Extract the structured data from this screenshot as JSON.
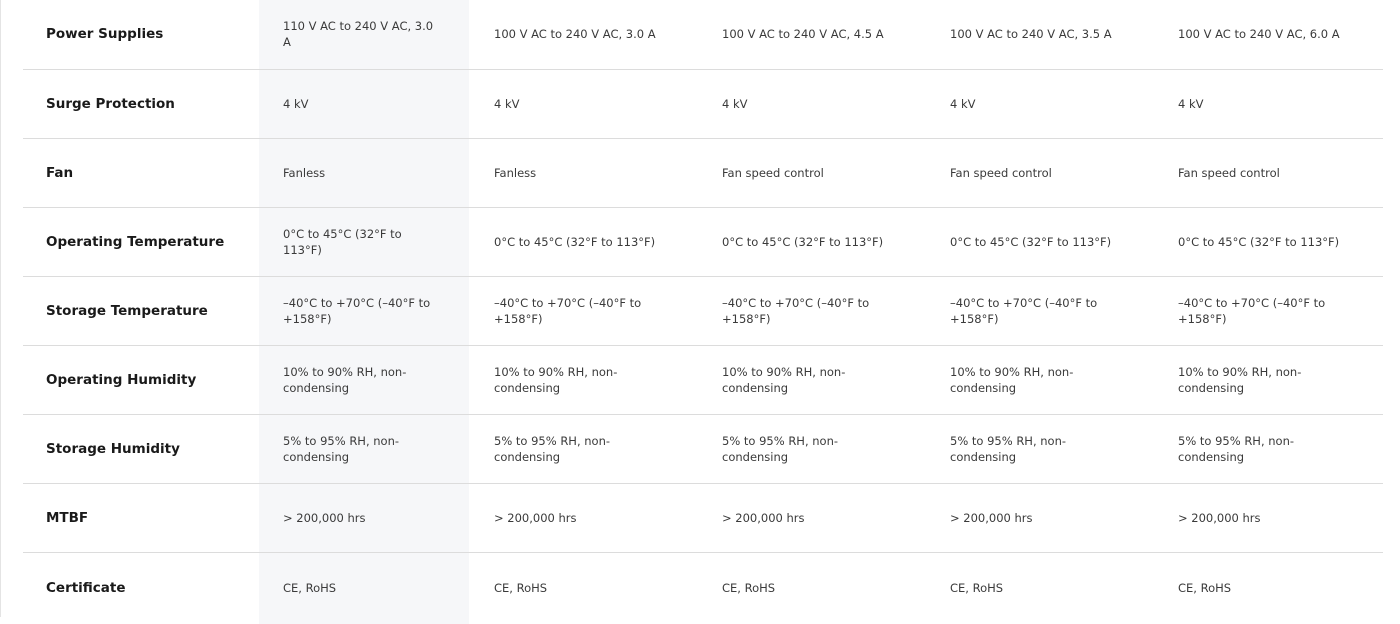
{
  "rows": [
    {
      "label": "Power Supplies",
      "values": [
        "110 V AC to 240 V AC, 3.0 A",
        "100 V AC to 240 V AC, 3.0 A",
        "100 V AC to 240 V AC, 4.5 A",
        "100 V AC to 240 V AC, 3.5 A",
        "100 V AC to 240 V AC, 6.0 A"
      ]
    },
    {
      "label": "Surge Protection",
      "values": [
        "4 kV",
        "4 kV",
        "4 kV",
        "4 kV",
        "4 kV"
      ]
    },
    {
      "label": "Fan",
      "values": [
        "Fanless",
        "Fanless",
        "Fan speed control",
        "Fan speed control",
        "Fan speed control"
      ]
    },
    {
      "label": "Operating Temperature",
      "values": [
        "0°C to 45°C (32°F to 113°F)",
        "0°C to 45°C (32°F to 113°F)",
        "0°C to 45°C (32°F to 113°F)",
        "0°C to 45°C (32°F to 113°F)",
        "0°C to 45°C (32°F to 113°F)"
      ]
    },
    {
      "label": "Storage Temperature",
      "values": [
        "–40°C to +70°C (–40°F to +158°F)",
        "–40°C to +70°C (–40°F to +158°F)",
        "–40°C to +70°C (–40°F to +158°F)",
        "–40°C to +70°C (–40°F to +158°F)",
        "–40°C to +70°C (–40°F to +158°F)"
      ]
    },
    {
      "label": "Operating Humidity",
      "values": [
        "10% to 90% RH, non-condensing",
        "10% to 90% RH, non-condensing",
        "10% to 90% RH, non-condensing",
        "10% to 90% RH, non-condensing",
        "10% to 90% RH, non-condensing"
      ]
    },
    {
      "label": "Storage Humidity",
      "values": [
        "5% to 95% RH, non-condensing",
        "5% to 95% RH, non-condensing",
        "5% to 95% RH, non-condensing",
        "5% to 95% RH, non-condensing",
        "5% to 95% RH, non-condensing"
      ]
    },
    {
      "label": "MTBF",
      "values": [
        "> 200,000 hrs",
        "> 200,000 hrs",
        "> 200,000 hrs",
        "> 200,000 hrs",
        "> 200,000 hrs"
      ]
    },
    {
      "label": "Certificate",
      "values": [
        "CE, RoHS",
        "CE, RoHS",
        "CE, RoHS",
        "CE, RoHS",
        "CE, RoHS"
      ]
    }
  ]
}
